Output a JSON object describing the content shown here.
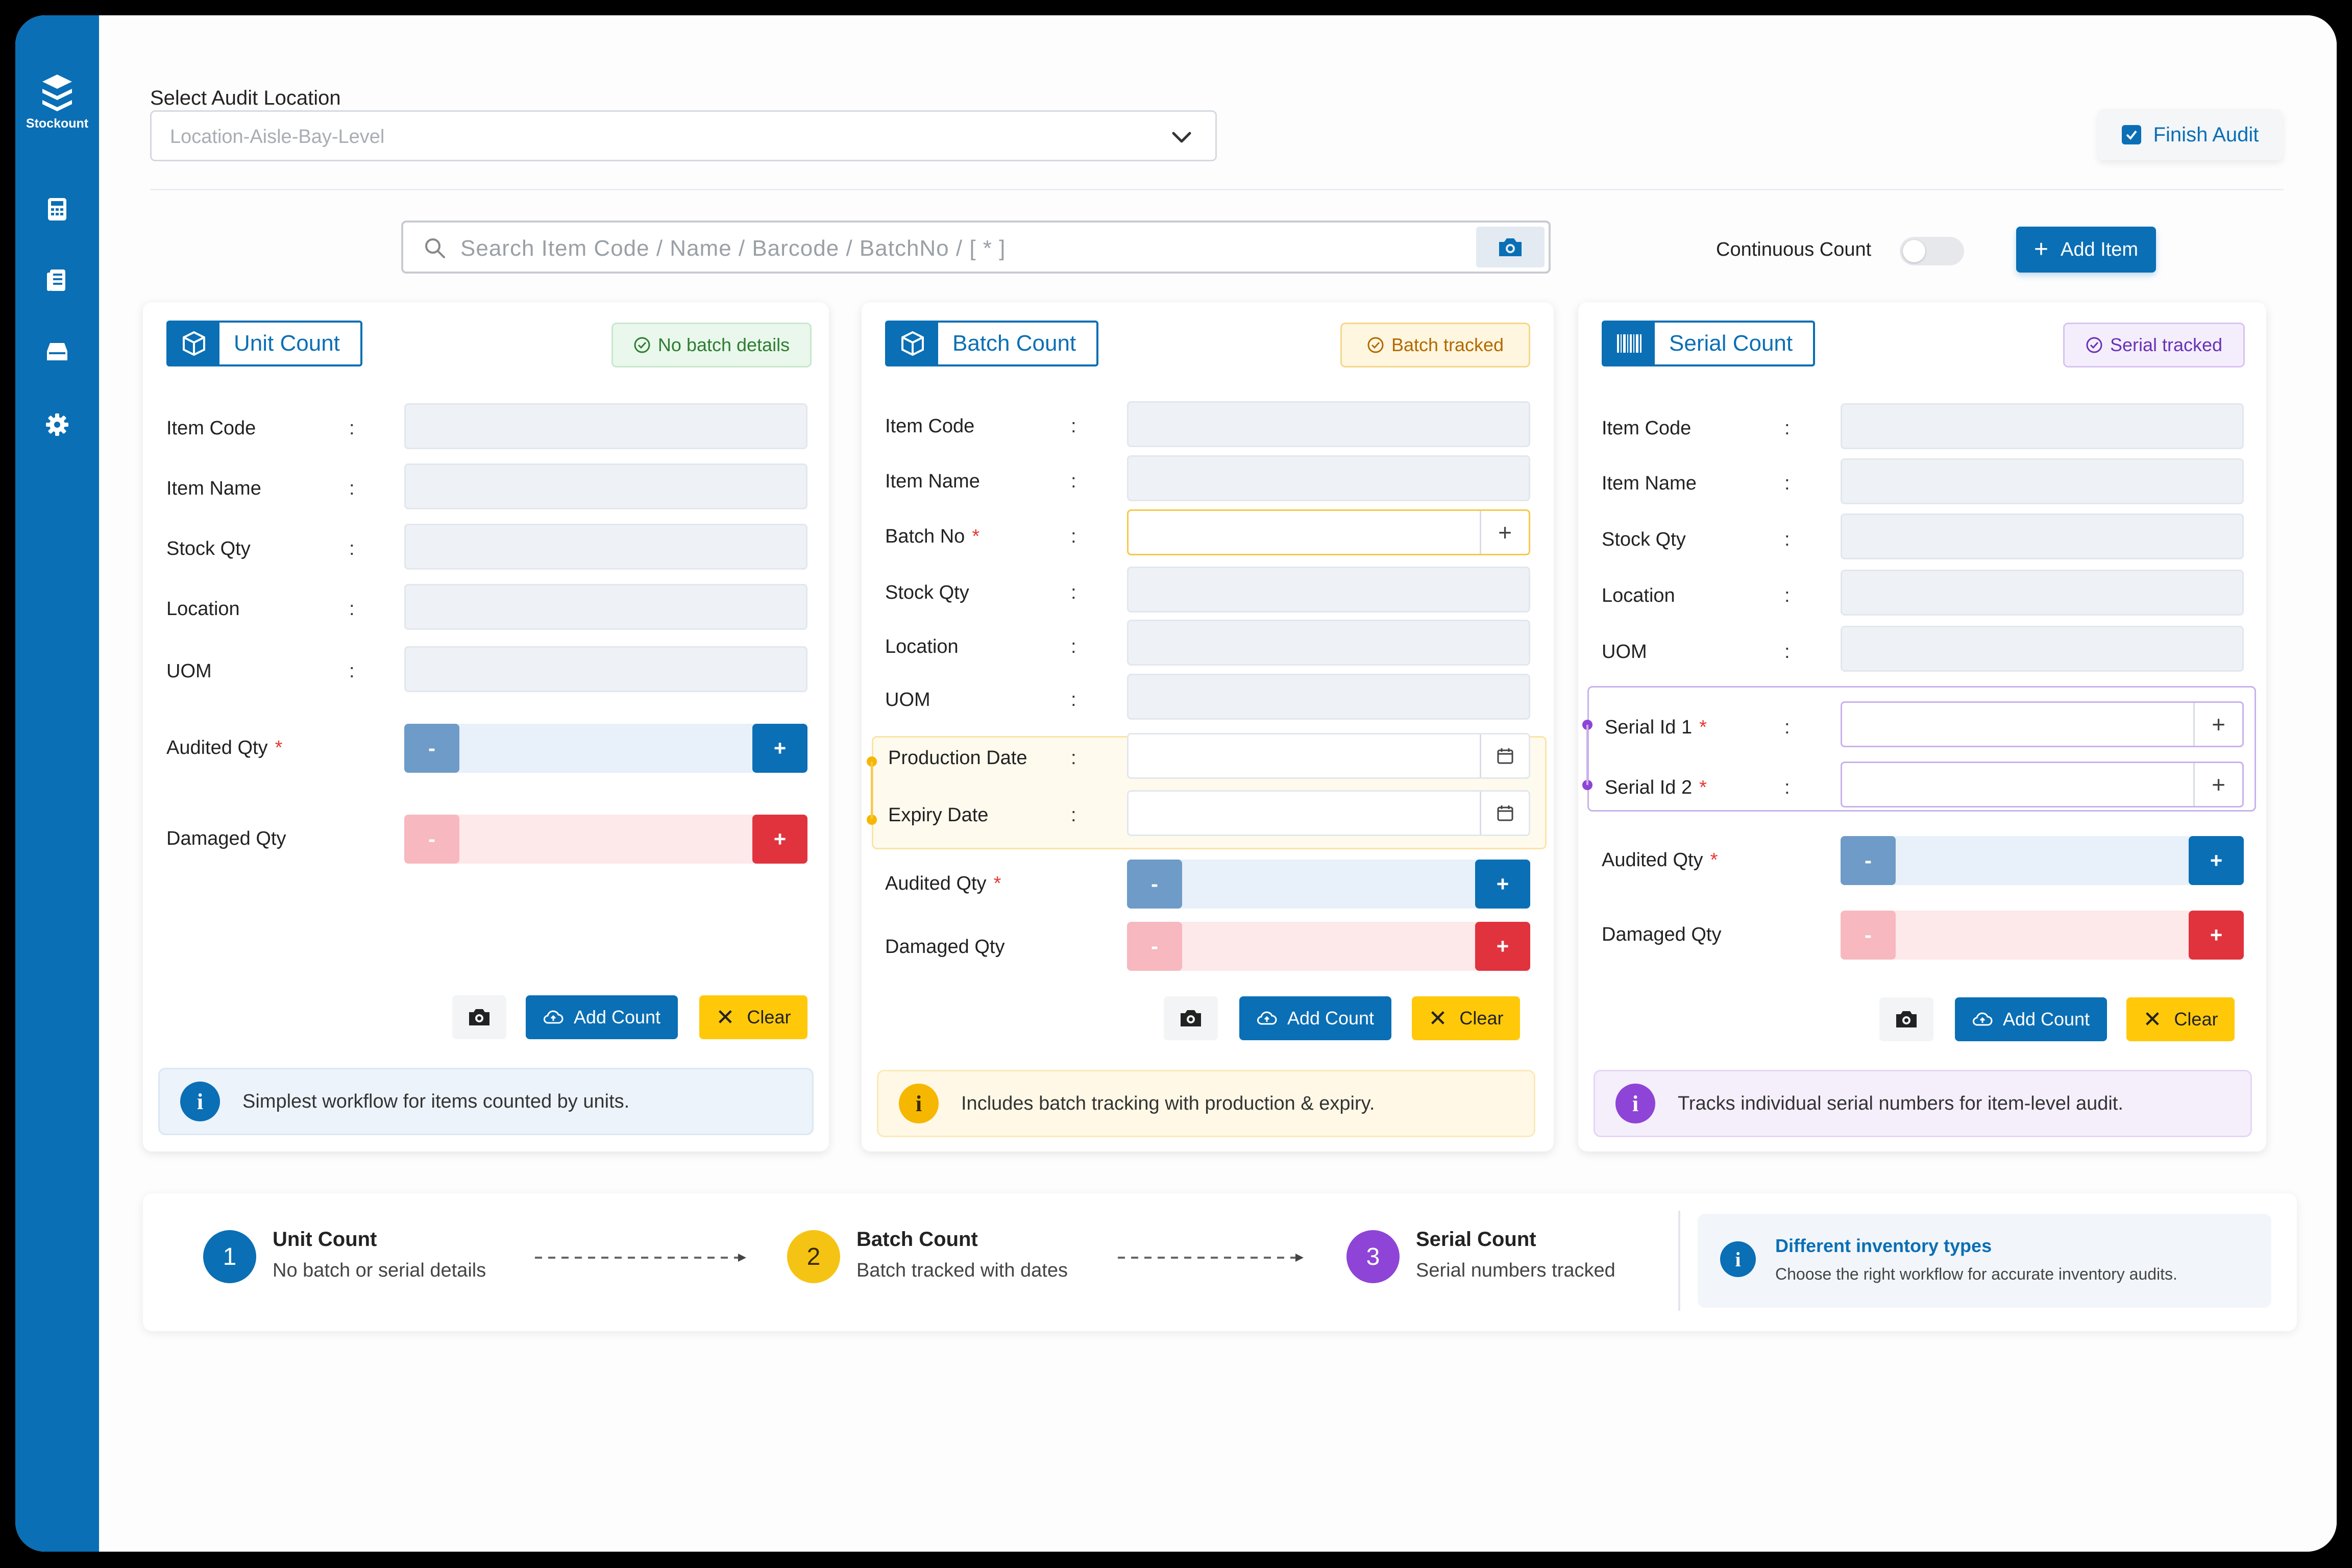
{
  "app": {
    "name": "Stockount"
  },
  "sidebar": {
    "items": [
      {
        "icon": "calculator-icon"
      },
      {
        "icon": "document-list-icon"
      },
      {
        "icon": "inbox-tray-icon"
      },
      {
        "icon": "gear-icon"
      }
    ]
  },
  "header": {
    "location_label": "Select Audit Location",
    "location_placeholder": "Location-Aisle-Bay-Level",
    "finish_label": "Finish Audit"
  },
  "search": {
    "placeholder": "Search Item Code / Name / Barcode / BatchNo / [ * ]",
    "continuous_label": "Continuous Count",
    "continuous_on": false,
    "add_item_label": "Add Item"
  },
  "colors": {
    "primary": "#0a6fb5",
    "batch_accent": "#f5b700",
    "serial_accent": "#8e44d6",
    "danger": "#e0333d"
  },
  "cards": {
    "unit": {
      "title": "Unit Count",
      "badge": "No batch details",
      "fields": [
        "Item Code",
        "Item Name",
        "Stock Qty",
        "Location",
        "UOM"
      ],
      "audited_label": "Audited Qty",
      "damaged_label": "Damaged Qty",
      "add_count_label": "Add Count",
      "clear_label": "Clear",
      "note": "Simplest workflow for items counted by units."
    },
    "batch": {
      "title": "Batch Count",
      "badge": "Batch tracked",
      "fields": [
        "Item Code",
        "Item Name",
        "Batch No",
        "Stock Qty",
        "Location",
        "UOM",
        "Production Date",
        "Expiry Date"
      ],
      "audited_label": "Audited Qty",
      "damaged_label": "Damaged Qty",
      "add_count_label": "Add Count",
      "clear_label": "Clear",
      "note": "Includes batch tracking with production & expiry."
    },
    "serial": {
      "title": "Serial Count",
      "badge": "Serial tracked",
      "fields": [
        "Item Code",
        "Item Name",
        "Stock Qty",
        "Location",
        "UOM",
        "Serial Id 1",
        "Serial Id 2"
      ],
      "audited_label": "Audited Qty",
      "damaged_label": "Damaged Qty",
      "add_count_label": "Add Count",
      "clear_label": "Clear",
      "note": "Tracks individual serial numbers for item-level audit."
    }
  },
  "stepper_glyphs": {
    "minus": "-",
    "plus": "+"
  },
  "steps": [
    {
      "number": "1",
      "title": "Unit Count",
      "subtitle": "No batch or serial details"
    },
    {
      "number": "2",
      "title": "Batch Count",
      "subtitle": "Batch tracked with dates"
    },
    {
      "number": "3",
      "title": "Serial Count",
      "subtitle": "Serial numbers tracked"
    }
  ],
  "tip": {
    "title": "Different inventory types",
    "subtitle": "Choose the right workflow for accurate inventory audits."
  }
}
